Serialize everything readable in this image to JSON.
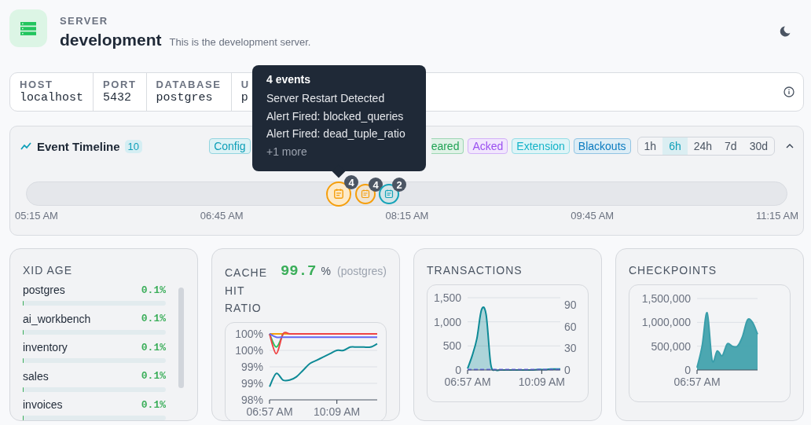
{
  "header": {
    "eyebrow": "SERVER",
    "title": "development",
    "description": "This is the development server."
  },
  "connection": [
    {
      "label": "HOST",
      "value": "localhost"
    },
    {
      "label": "PORT",
      "value": "5432"
    },
    {
      "label": "DATABASE",
      "value": "postgres"
    },
    {
      "label": "U",
      "value": "p"
    }
  ],
  "timeline": {
    "title": "Event Timeline",
    "count": "10",
    "expanded": true,
    "filters": [
      {
        "label": "Config",
        "color": "#0e9fb8"
      },
      {
        "label": "eared",
        "color": "#22a355"
      },
      {
        "label": "Acked",
        "color": "#9a4ff0"
      },
      {
        "label": "Extension",
        "color": "#13b3c8"
      },
      {
        "label": "Blackouts",
        "color": "#0b7bc0"
      }
    ],
    "ranges": [
      {
        "label": "1h",
        "selected": false
      },
      {
        "label": "6h",
        "selected": true
      },
      {
        "label": "24h",
        "selected": false
      },
      {
        "label": "7d",
        "selected": false
      },
      {
        "label": "30d",
        "selected": false
      }
    ],
    "markers": [
      {
        "count": "4",
        "color": "#f59e0b",
        "selected": true
      },
      {
        "count": "4",
        "color": "#f59e0b",
        "selected": false
      },
      {
        "count": "2",
        "color": "#15a3b8",
        "selected": false
      }
    ],
    "axis": [
      "05:15 AM",
      "06:45 AM",
      "08:15 AM",
      "09:45 AM",
      "11:15 AM"
    ],
    "tooltip": {
      "title": "4 events",
      "lines": [
        "Server Restart Detected",
        "Alert Fired: blocked_queries",
        "Alert Fired: dead_tuple_ratio"
      ],
      "more": "+1 more"
    }
  },
  "cards": [
    {
      "kind": "list",
      "title": "XID AGE",
      "rows": [
        {
          "name": "postgres",
          "value": "0.1%",
          "level": 0.001
        },
        {
          "name": "ai_workbench",
          "value": "0.1%",
          "level": 0.001
        },
        {
          "name": "inventory",
          "value": "0.1%",
          "level": 0.001
        },
        {
          "name": "sales",
          "value": "0.1%",
          "level": 0.001
        },
        {
          "name": "invoices",
          "value": "0.1%",
          "level": 0.001
        }
      ]
    },
    {
      "kind": "stat",
      "title": "CACHE HIT RATIO",
      "value": "99.7",
      "unit": "%",
      "note": "(postgres)",
      "chart_data": {
        "type": "line",
        "categories": [
          "06:57 AM",
          null,
          null,
          null,
          null,
          null,
          null,
          null,
          null,
          null,
          "10:09 AM",
          null,
          null,
          null,
          null,
          null,
          null
        ],
        "ylim": [
          98,
          100
        ],
        "grid": true,
        "yticks": [
          {
            "value": 100,
            "label": "100%"
          },
          {
            "value": 99.5,
            "label": "100%"
          },
          {
            "value": 99,
            "label": "99%"
          },
          {
            "value": 98.5,
            "label": "99%"
          },
          {
            "value": 98,
            "label": "98%"
          }
        ],
        "series": [
          {
            "color": "#f59e0b",
            "values": [
              100,
              100,
              100,
              100,
              null,
              null,
              null,
              null,
              null,
              null,
              null,
              null,
              null,
              null,
              null,
              null,
              null
            ]
          },
          {
            "color": "#22c55e",
            "values": [
              100,
              99.6,
              100,
              null,
              null,
              null,
              null,
              null,
              null,
              null,
              null,
              null,
              null,
              null,
              null,
              null,
              null
            ]
          },
          {
            "color": "#ef4444",
            "values": [
              100,
              99.4,
              100,
              100,
              100,
              100,
              100,
              100,
              100,
              100,
              100,
              100,
              100,
              100,
              100,
              100,
              100
            ]
          },
          {
            "color": "#6366f1",
            "values": [
              100,
              99.9,
              99.9,
              99.9,
              99.9,
              99.9,
              99.9,
              99.9,
              99.9,
              99.9,
              99.9,
              99.9,
              99.9,
              99.9,
              99.9,
              99.9,
              99.9
            ]
          },
          {
            "color": "#0e8a96",
            "values": [
              98.4,
              98.8,
              98.6,
              98.6,
              98.7,
              98.9,
              99.1,
              99.2,
              99.3,
              99.4,
              99.5,
              99.5,
              99.6,
              99.6,
              99.6,
              99.6,
              99.7
            ]
          }
        ]
      }
    },
    {
      "kind": "chart",
      "title": "TRANSACTIONS",
      "chart_data": {
        "type": "area",
        "categories": [
          "06:57 AM",
          null,
          null,
          null,
          null,
          null,
          null,
          null,
          null,
          null,
          null,
          null,
          null,
          null,
          null,
          null,
          "10:09 AM",
          null,
          null,
          null,
          null
        ],
        "ylim": [
          0,
          1500
        ],
        "grid": true,
        "yticks": [
          {
            "value": 0,
            "label": "0"
          },
          {
            "value": 500,
            "label": "500"
          },
          {
            "value": 1000,
            "label": "1,000"
          },
          {
            "value": 1500,
            "label": "1,500"
          }
        ],
        "y2lim": [
          0,
          100
        ],
        "y2ticks": [
          0,
          30,
          60,
          90
        ],
        "series": [
          {
            "color": "#0e8a96",
            "values": [
              30,
              300,
              650,
              1250,
              1150,
              120,
              0,
              0,
              0,
              0,
              0,
              0,
              0,
              0,
              0,
              10,
              10,
              10,
              20,
              20,
              20
            ]
          },
          {
            "color": "#6366f1",
            "values": [
              10,
              10,
              10,
              10,
              10,
              10,
              10,
              10,
              10,
              10,
              10,
              10,
              10,
              10,
              10,
              10,
              10,
              10,
              10,
              10,
              10
            ]
          }
        ]
      }
    },
    {
      "kind": "chart",
      "title": "CHECKPOINTS",
      "chart_data": {
        "type": "area",
        "categories": [
          "06:57 AM",
          null,
          null,
          null,
          null,
          null,
          null,
          null,
          null,
          null,
          null,
          null,
          null
        ],
        "ylim": [
          0,
          1500000
        ],
        "grid": true,
        "yticks": [
          {
            "value": 0,
            "label": "0"
          },
          {
            "value": 500000,
            "label": "500,000"
          },
          {
            "value": 1000000,
            "label": "1,000,000"
          },
          {
            "value": 1500000,
            "label": "1,500,000"
          }
        ],
        "series": [
          {
            "color": "#3a9eaa",
            "values": [
              50000,
              500000,
              1200000,
              200000,
              400000,
              300000,
              550000,
              500000,
              500000,
              700000,
              1050000,
              1000000,
              750000
            ]
          }
        ]
      }
    }
  ]
}
